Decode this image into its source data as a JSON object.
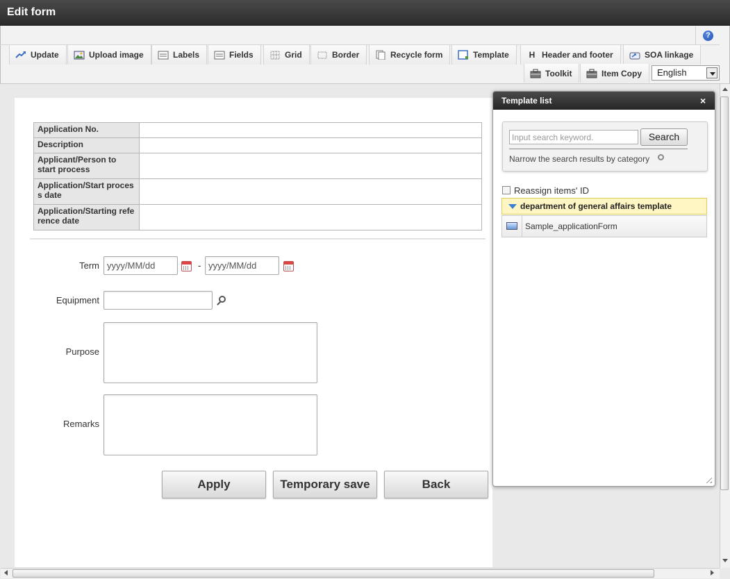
{
  "window": {
    "title": "Edit form"
  },
  "toolbar": {
    "tabs": [
      {
        "label": "Update",
        "icon": "update-icon"
      },
      {
        "label": "Upload image",
        "icon": "upload-image-icon"
      },
      {
        "label": "Labels",
        "icon": "labels-icon"
      },
      {
        "label": "Fields",
        "icon": "fields-icon"
      },
      {
        "label": "Grid",
        "icon": "grid-icon"
      },
      {
        "label": "Border",
        "icon": "border-icon"
      },
      {
        "label": "Recycle form",
        "icon": "recycle-form-icon"
      },
      {
        "label": "Template",
        "icon": "template-icon"
      },
      {
        "label": "Header and footer",
        "icon": "header-footer-icon",
        "glyph": "H"
      },
      {
        "label": "SOA linkage",
        "icon": "soa-linkage-icon"
      },
      {
        "label": "Toolkit",
        "icon": "toolkit-icon"
      },
      {
        "label": "Item Copy",
        "icon": "item-copy-icon"
      }
    ],
    "help_glyph": "?",
    "language": {
      "selected": "English"
    }
  },
  "form": {
    "info_table": [
      {
        "label": "Application No.",
        "value": ""
      },
      {
        "label": "Description",
        "value": ""
      },
      {
        "label": "Applicant/Person to start process",
        "value": ""
      },
      {
        "label": "Application/Start proces s date",
        "value": ""
      },
      {
        "label": "Application/Starting refe rence date",
        "value": ""
      }
    ],
    "term": {
      "label": "Term",
      "from_placeholder": "yyyy/MM/dd",
      "separator": "-",
      "to_placeholder": "yyyy/MM/dd"
    },
    "equipment": {
      "label": "Equipment",
      "value": ""
    },
    "purpose": {
      "label": "Purpose",
      "value": ""
    },
    "remarks": {
      "label": "Remarks",
      "value": ""
    },
    "buttons": {
      "apply": "Apply",
      "temporary_save": "Temporary save",
      "back": "Back"
    }
  },
  "template_panel": {
    "title": "Template list",
    "close_glyph": "×",
    "search": {
      "placeholder": "Input search keyword.",
      "button": "Search",
      "narrow_text": "Narrow the search results by category"
    },
    "reassign_label": "Reassign items' ID",
    "category": "department of general affairs template",
    "items": [
      "Sample_applicationForm"
    ]
  },
  "colors": {
    "title_bar": "#2b2b2b",
    "category_highlight": "#fff6c4",
    "accent_arrow": "#3a7fd4"
  }
}
